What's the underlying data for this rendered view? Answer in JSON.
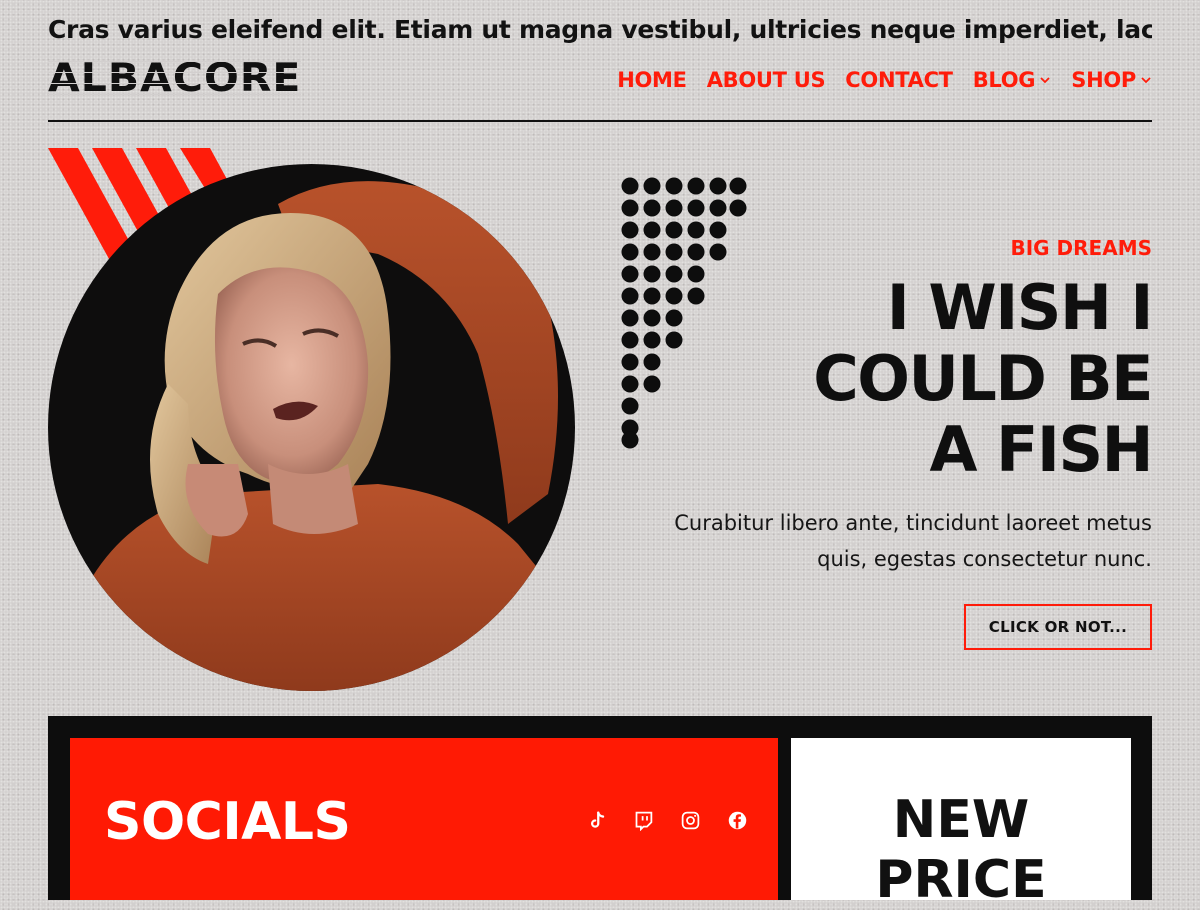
{
  "ticker": {
    "text": "Cras varius eleifend elit. Etiam ut magna vestibul, ultricies neque imperdiet, laci"
  },
  "site": {
    "logo": "ALBACORE"
  },
  "nav": {
    "items": [
      {
        "label": "HOME",
        "has_dropdown": false
      },
      {
        "label": "ABOUT US",
        "has_dropdown": false
      },
      {
        "label": "CONTACT",
        "has_dropdown": false
      },
      {
        "label": "BLOG",
        "has_dropdown": true
      },
      {
        "label": "SHOP",
        "has_dropdown": true
      }
    ]
  },
  "hero": {
    "eyebrow": "BIG DREAMS",
    "headline": "I WISH I\nCOULD BE\nA FISH",
    "lede": "Curabitur libero ante, tincidunt laoreet metus quis, egestas consectetur nunc.",
    "cta_label": "CLICK OR NOT..."
  },
  "socials": {
    "title": "SOCIALS",
    "icons": [
      "tiktok-icon",
      "twitch-icon",
      "instagram-icon",
      "facebook-icon"
    ]
  },
  "price": {
    "title": "NEW\nPRICE"
  },
  "colors": {
    "accent": "#ff1c0a",
    "background": "#d2cfce",
    "ink": "#111111",
    "panel_white": "#ffffff"
  }
}
